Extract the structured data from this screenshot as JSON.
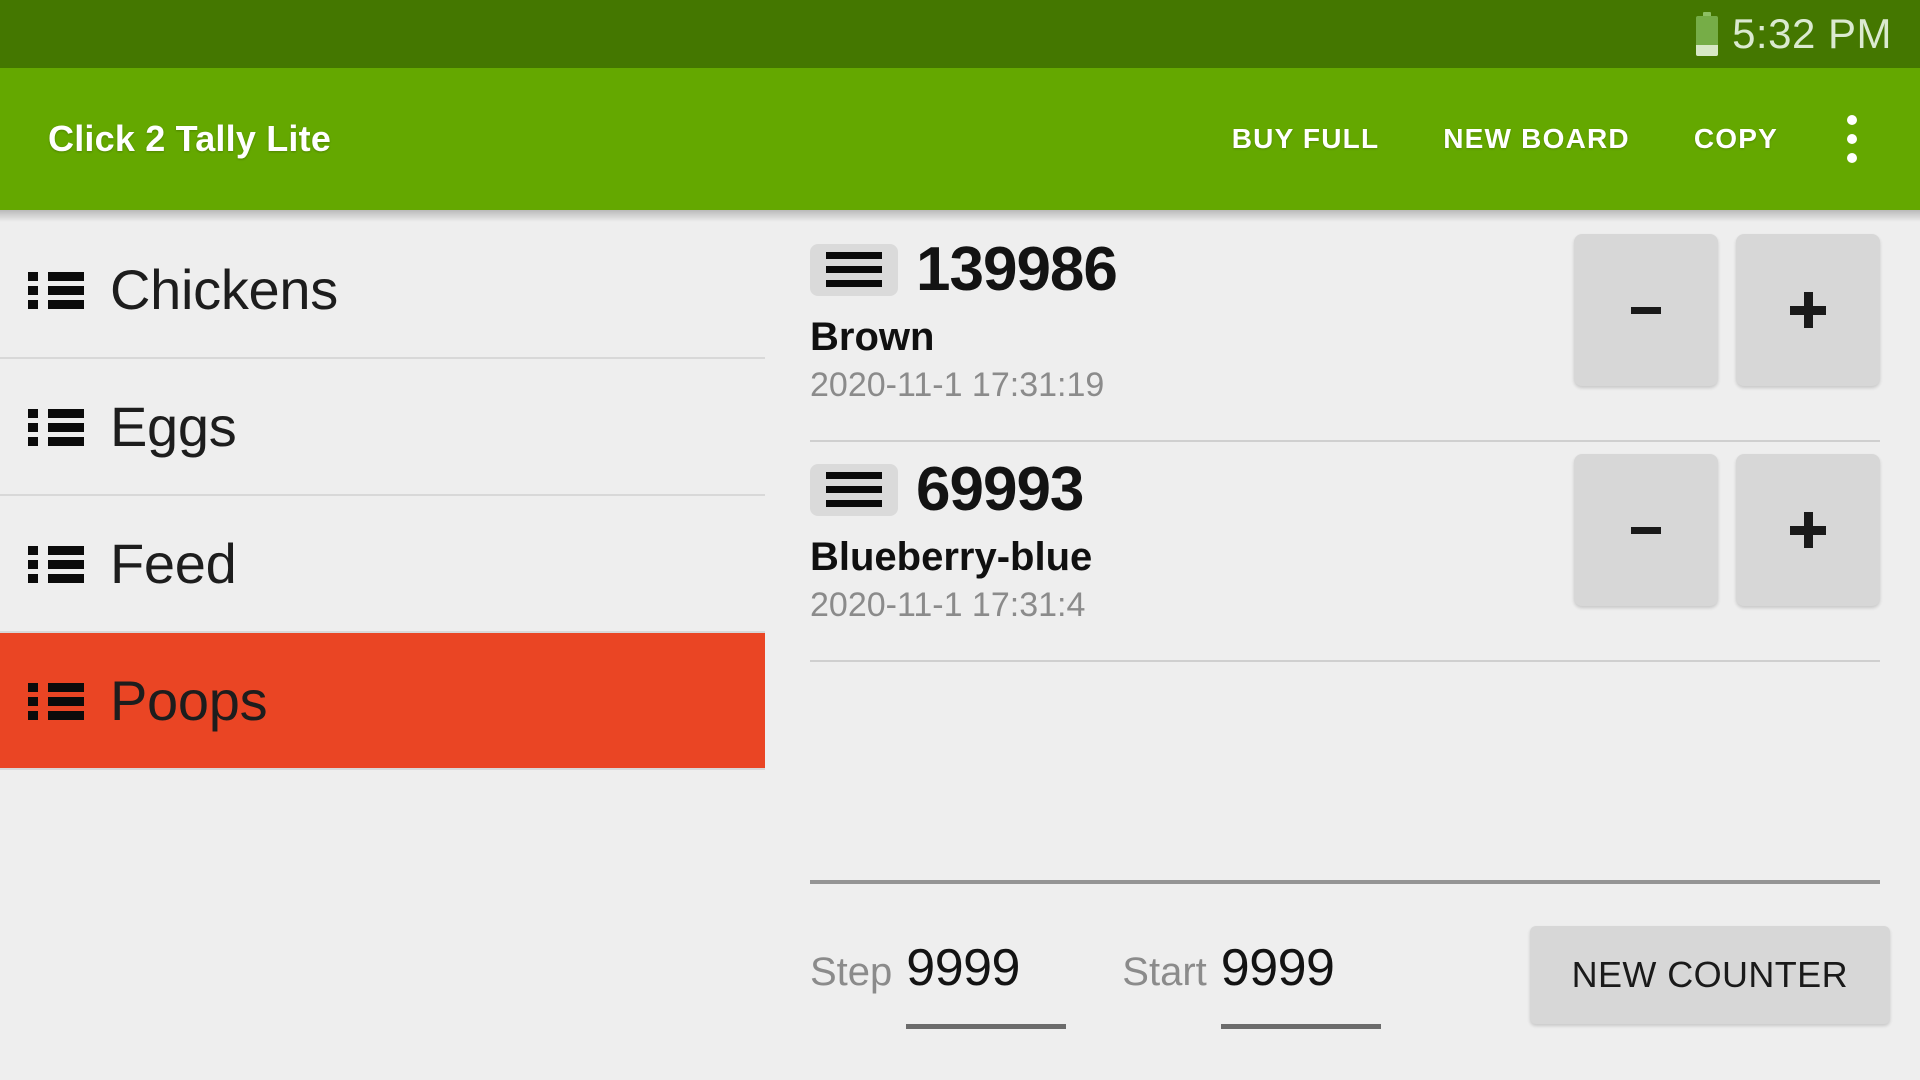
{
  "statusbar": {
    "battery_icon": "battery-icon",
    "time": "5:32 PM"
  },
  "appbar": {
    "title": "Click 2 Tally Lite",
    "background_color": "#64a800",
    "actions": [
      {
        "label": "BUY FULL",
        "name": "buy-full-button"
      },
      {
        "label": "NEW BOARD",
        "name": "new-board-button"
      },
      {
        "label": "COPY",
        "name": "copy-button"
      }
    ],
    "overflow_icon": "more-vertical-icon"
  },
  "sidebar": {
    "selected_color": "#ea4524",
    "items": [
      {
        "label": "Chickens",
        "icon": "list-icon",
        "selected": false
      },
      {
        "label": "Eggs",
        "icon": "list-icon",
        "selected": false
      },
      {
        "label": "Feed",
        "icon": "list-icon",
        "selected": false
      },
      {
        "label": "Poops",
        "icon": "list-icon",
        "selected": true
      }
    ]
  },
  "main": {
    "counters": [
      {
        "value": "139986",
        "name": "Brown",
        "timestamp": "2020-11-1 17:31:19",
        "drag_icon": "hamburger-icon",
        "decrement_label": "−",
        "increment_label": "+"
      },
      {
        "value": "69993",
        "name": "Blueberry-blue",
        "timestamp": "2020-11-1 17:31:4",
        "drag_icon": "hamburger-icon",
        "decrement_label": "−",
        "increment_label": "+"
      }
    ],
    "footer": {
      "step_label": "Step",
      "step_value": "9999",
      "start_label": "Start",
      "start_value": "9999",
      "new_counter_label": "NEW COUNTER"
    }
  }
}
